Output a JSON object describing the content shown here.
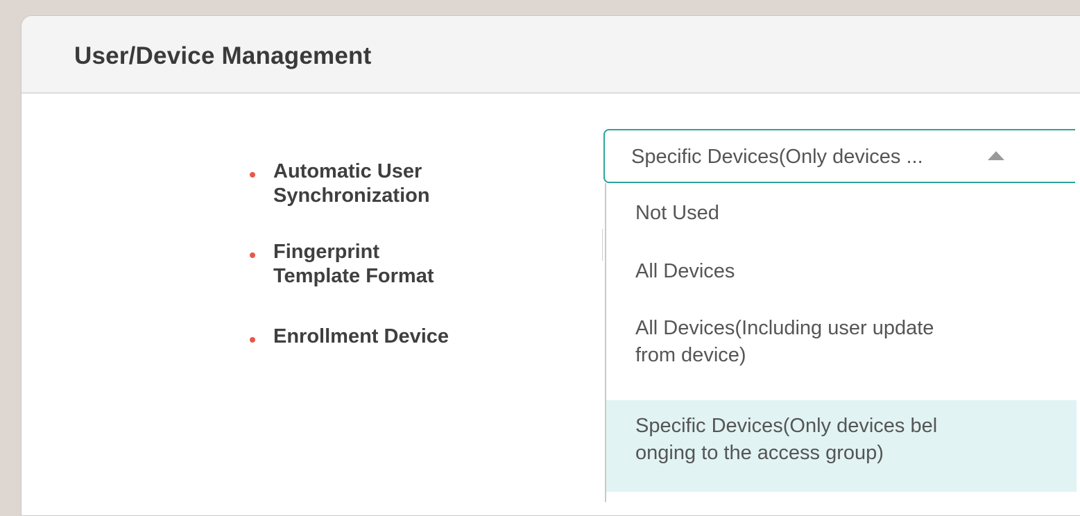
{
  "panel": {
    "title": "User/Device Management"
  },
  "fields": [
    {
      "label_line1": "Automatic User",
      "label_line2": "Synchronization"
    },
    {
      "label_line1": "Fingerprint",
      "label_line2": "Template Format"
    },
    {
      "label_line1": "Enrollment Device",
      "label_line2": ""
    }
  ],
  "sync_select": {
    "value": "Specific Devices(Only devices ...",
    "options": [
      {
        "line1": "Not Used",
        "line2": ""
      },
      {
        "line1": "All Devices",
        "line2": ""
      },
      {
        "line1": "All Devices(Including user update",
        "line2": "from device)"
      },
      {
        "line1": "Specific Devices(Only devices bel",
        "line2": "onging to the access group)"
      }
    ],
    "selected_index": 3
  },
  "colors": {
    "accent": "#2aa49a",
    "bullet": "#e8574a",
    "selected_option_bg": "#e1f3f3",
    "page_bg": "#ddd6d1"
  },
  "icons": {
    "dropdown_arrow": "chevron-up-icon"
  }
}
